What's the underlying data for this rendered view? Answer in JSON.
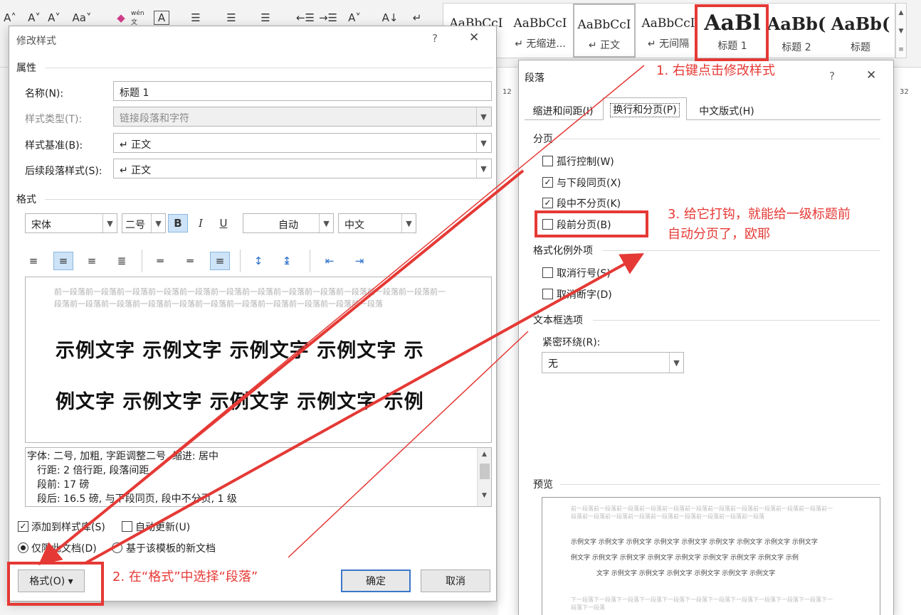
{
  "ribbon": {
    "buttons": [
      "A˄",
      "A˅",
      "Aa˅",
      "wén 文",
      "A",
      "☰",
      "☰",
      "☰",
      "←☰",
      "→☰",
      "A˅",
      "A↓",
      "↵"
    ],
    "styles": [
      {
        "sample": "AaBbCcI",
        "name": ""
      },
      {
        "sample": "AaBbCcI",
        "name": "↵ 无缩进..."
      },
      {
        "sample": "AaBbCcI",
        "name": "↵ 正文"
      },
      {
        "sample": "AaBbCcI",
        "name": "↵ 无间隔"
      },
      {
        "sample": "AaBl",
        "name": "标题 1"
      },
      {
        "sample": "AaBb(",
        "name": "标题 2"
      },
      {
        "sample": "AaBb(",
        "name": "标题"
      }
    ],
    "ruler_marks": [
      "12",
      "32"
    ]
  },
  "modify_dialog": {
    "title": "修改样式",
    "help": "?",
    "close": "✕",
    "props_section": "属性",
    "name_label": "名称(N):",
    "name_value": "标题 1",
    "type_label": "样式类型(T):",
    "type_value": "链接段落和字符",
    "base_label": "样式基准(B):",
    "base_value": "↵ 正文",
    "next_label": "后续段落样式(S):",
    "next_value": "↵ 正文",
    "format_section": "格式",
    "font": "宋体",
    "size": "二号",
    "bold": "B",
    "italic": "I",
    "underline": "U",
    "color": "自动",
    "script": "中文",
    "preview_prev": "前一段落前一段落前一段落前一段落前一段落前一段落前一段落前一段落前一段落前一段落前一段落前一段落前一段落前一段落前一段落前一段落前一段落前一段落前一段落前一段落前一段落前一段落前一段落",
    "preview_line1": "示例文字 示例文字 示例文字 示例文字 示",
    "preview_line2": "例文字 示例文字 示例文字 示例文字 示例",
    "desc_lines": [
      "字体: 二号, 加粗, 字距调整二号, 缩进: 居中",
      "行距: 2 倍行距, 段落间距",
      "段前: 17 磅",
      "段后: 16.5 磅, 与下段同页, 段中不分页, 1 级"
    ],
    "add_gallery": "添加到样式库(S)",
    "auto_update": "自动更新(U)",
    "only_doc": "仅限此文档(D)",
    "template_doc": "基于该模板的新文档",
    "format_btn": "格式(O) ▾",
    "ok": "确定",
    "cancel": "取消"
  },
  "para_dialog": {
    "title": "段落",
    "help": "?",
    "close": "✕",
    "tabs": [
      "缩进和间距(I)",
      "换行和分页(P)",
      "中文版式(H)"
    ],
    "paging_section": "分页",
    "widow": "孤行控制(W)",
    "keep_next": "与下段同页(X)",
    "keep_lines": "段中不分页(K)",
    "page_break": "段前分页(B)",
    "except_section": "格式化例外项",
    "suppress_ln": "取消行号(S)",
    "no_hyph": "取消断字(D)",
    "textbox_section": "文本框选项",
    "tight_label": "紧密环绕(R):",
    "tight_value": "无",
    "preview_section": "预览",
    "mini_prev": "前一段落前一段落前一段落前一段落前一段落前一段落前一段落前一段落前一段落前一段落前一段落前一段落前一段落前一段落前一段落前一段落前一段落前一段落前一段落前一段落",
    "mini_lines": [
      "示例文字 示例文字 示例文字 示例文字 示例文字 示例文字 示例文字 示例文字 示例文字",
      "例文字 示例文字 示例文字 示例文字 示例文字 示例文字 示例文字 示例文字 示例",
      "文字 示例文字 示例文字 示例文字 示例文字 示例文字 示例文字"
    ],
    "mini_next": "下一段落下一段落下一段落下一段落下一段落下一段落下一段落下一段落下一段落下一段落下一段落下一段落下一段落"
  },
  "annotations": {
    "step1": "1. 右键点击修改样式",
    "step2": "2. 在“格式”中选择“段落”",
    "step3_line1": "3. 给它打钩，就能给一级标题前",
    "step3_line2": "自动分页了，欧耶"
  },
  "colors": {
    "annotation": "#e53935",
    "selection": "#cde3f7"
  }
}
